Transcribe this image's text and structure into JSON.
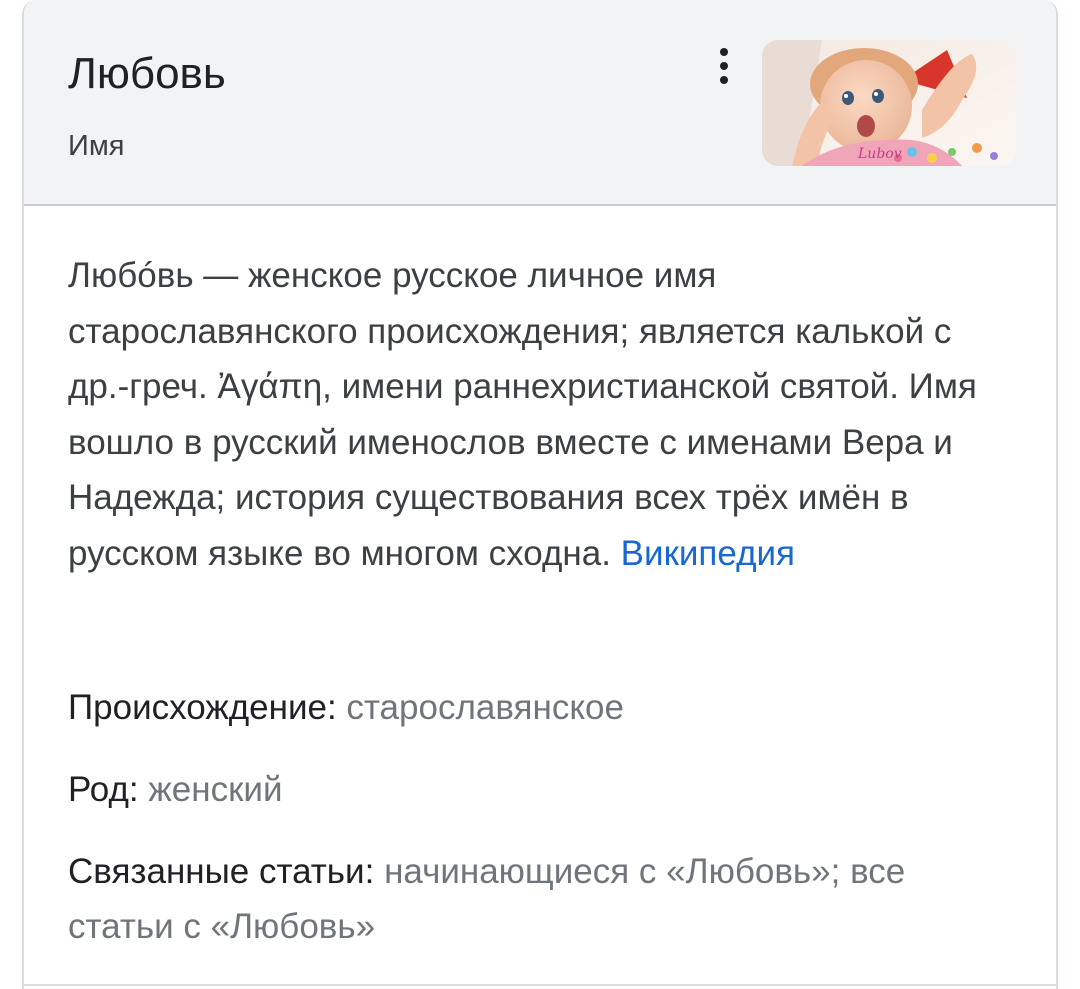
{
  "entity": {
    "title": "Любовь",
    "subtitle": "Имя",
    "menu_icon": "more-vert-icon",
    "thumbnail_caption": "Lubov"
  },
  "description": {
    "text": "Любóвь — женское русское личное имя старославянского происхождения; является калькой с др.-греч. Ἀγάπη, имени раннехристианской святой. Имя вошло в русский именослов вместе с именами Вера и Надежда; история существования всех трёх имён в русском языке во многом сходна.",
    "source_link": "Википедия"
  },
  "facts": {
    "origin_label": "Происхождение:",
    "origin_value": "старославянское",
    "gender_label": "Род:",
    "gender_value": "женский",
    "related_label": "Связанные статьи:",
    "related_link_1": "начинающиеся с «Любовь»",
    "related_separator": ";",
    "related_link_2": "все статьи с «Любовь»"
  },
  "colors": {
    "header_bg": "#f1f3f4",
    "link": "#1967d2",
    "secondary_text": "#70757a"
  }
}
